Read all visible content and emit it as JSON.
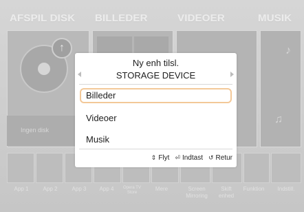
{
  "categories": [
    "AFSPIL DISK",
    "BILLEDER",
    "VIDEOER",
    "MUSIK"
  ],
  "disk_panel": {
    "status": "Ingen disk"
  },
  "apps": [
    {
      "label": "App 1"
    },
    {
      "label": "App 2"
    },
    {
      "label": "App 3"
    },
    {
      "label": "App 4"
    },
    {
      "label": "Opera TV Store"
    },
    {
      "label": "Mere"
    },
    {
      "label": "Screen Mirroring"
    },
    {
      "label": "Skift enhed"
    },
    {
      "label": "Funktion"
    },
    {
      "label": "Indstill."
    }
  ],
  "dialog": {
    "title": "Ny enh tilsl.",
    "subtitle": "STORAGE DEVICE",
    "items": [
      {
        "label": "Billeder",
        "selected": true
      },
      {
        "label": "Videoer",
        "selected": false
      },
      {
        "label": "Musik",
        "selected": false
      }
    ],
    "hints": [
      {
        "icon": "updown-icon",
        "glyph": "⇕",
        "label": "Flyt"
      },
      {
        "icon": "enter-icon",
        "glyph": "⏎",
        "label": "Indtast"
      },
      {
        "icon": "return-icon",
        "glyph": "↺",
        "label": "Retur"
      }
    ]
  },
  "colors": {
    "selection_border": "#f3c898",
    "dialog_bg": "#ffffff",
    "screen_bg": "#cfcfcf"
  }
}
